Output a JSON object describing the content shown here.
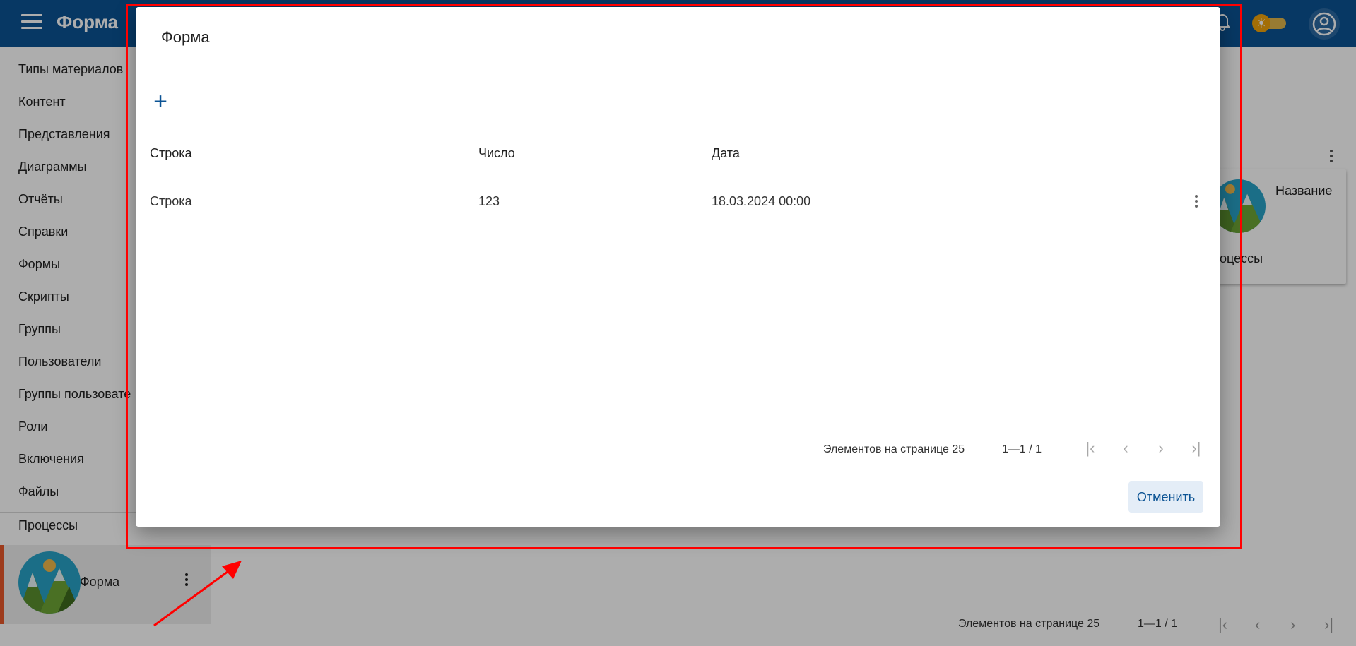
{
  "app": {
    "title": "Форма"
  },
  "sidebar": {
    "items": [
      {
        "label": "Типы материалов"
      },
      {
        "label": "Контент"
      },
      {
        "label": "Представления"
      },
      {
        "label": "Диаграммы"
      },
      {
        "label": "Отчёты"
      },
      {
        "label": "Справки"
      },
      {
        "label": "Формы"
      },
      {
        "label": "Скрипты"
      },
      {
        "label": "Группы"
      },
      {
        "label": "Пользователи"
      },
      {
        "label": "Группы пользовате"
      },
      {
        "label": "Роли"
      },
      {
        "label": "Включения"
      },
      {
        "label": "Файлы"
      },
      {
        "label": "Процессы"
      }
    ],
    "selected": {
      "label": "Форма"
    }
  },
  "background_card": {
    "title": "Название",
    "subtitle": "Процессы"
  },
  "background_pager": {
    "items_per_page": "Элементов на странице 25",
    "range": "1—1 / 1"
  },
  "dialog": {
    "title": "Форма",
    "add_icon": "plus-icon",
    "table": {
      "columns": [
        "Строка",
        "Число",
        "Дата"
      ],
      "rows": [
        {
          "cells": [
            "Строка",
            "123",
            "18.03.2024 00:00"
          ]
        }
      ]
    },
    "pager": {
      "items_per_page": "Элементов на странице 25",
      "range": "1—1 / 1"
    },
    "cancel_label": "Отменить"
  },
  "colors": {
    "primary": "#0b5394",
    "accent": "#e8582a",
    "annotation": "#ff0000"
  }
}
